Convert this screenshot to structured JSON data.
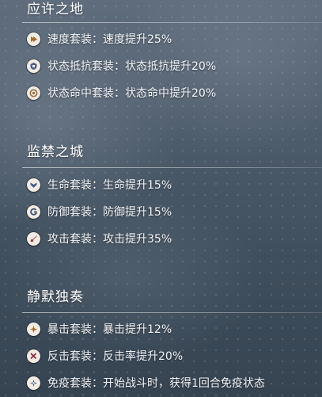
{
  "sections": [
    {
      "title": "应许之地",
      "items": [
        {
          "icon": "speed-set-icon",
          "accent": "#a86a2b",
          "text": "速度套装：速度提升25%"
        },
        {
          "icon": "resistance-set-icon",
          "accent": "#4a5f8a",
          "text": "状态抵抗套装：状态抵抗提升20%"
        },
        {
          "icon": "accuracy-set-icon",
          "accent": "#9a6a3a",
          "text": "状态命中套装：状态命中提升20%"
        }
      ]
    },
    {
      "title": "监禁之城",
      "items": [
        {
          "icon": "health-set-icon",
          "accent": "#3f5a8c",
          "text": "生命套装：生命提升15%"
        },
        {
          "icon": "defense-set-icon",
          "accent": "#3c4f78",
          "text": "防御套装：防御提升15%"
        },
        {
          "icon": "attack-set-icon",
          "accent": "#8c2e3a",
          "text": "攻击套装：攻击提升35%"
        }
      ]
    },
    {
      "title": "静默独奏",
      "items": [
        {
          "icon": "critical-set-icon",
          "accent": "#a86a2b",
          "text": "暴击套装：暴击提升12%"
        },
        {
          "icon": "counter-set-icon",
          "accent": "#8c2e3a",
          "text": "反击套装：反击率提升20%"
        },
        {
          "icon": "immunity-set-icon",
          "accent": "#3f5a8c",
          "text": "免疫套装：开始战斗时，获得1回合免疫状态"
        }
      ]
    }
  ]
}
